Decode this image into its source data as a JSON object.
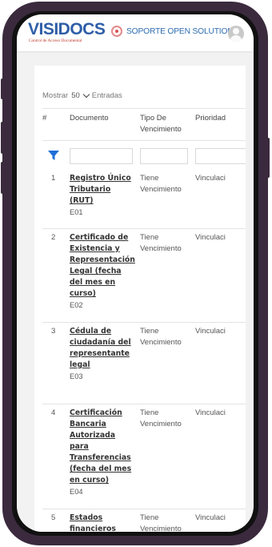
{
  "header": {
    "logo_text": "VISIDOCS",
    "logo_subtitle": "Control de Acceso Documental",
    "support_label": "SOPORTE OPEN SOLUTIONS"
  },
  "table": {
    "show_prefix": "Mostrar",
    "page_size": "50",
    "show_suffix": "Entradas",
    "columns": {
      "num": "#",
      "documento": "Documento",
      "tipo_line1": "Tipo De",
      "tipo_line2": "Vencimiento",
      "prioridad": "Prioridad"
    },
    "rows": [
      {
        "num": "1",
        "name": "Registro Único Tributario (RUT)",
        "code": "E01",
        "tipo1": "Tiene",
        "tipo2": "Vencimiento",
        "prioridad": "Vinculaci"
      },
      {
        "num": "2",
        "name": "Certificado de Existencia y Representación Legal (fecha del mes en curso)",
        "code": "E02",
        "tipo1": "Tiene",
        "tipo2": "Vencimiento",
        "prioridad": "Vinculaci"
      },
      {
        "num": "3",
        "name": "Cédula de ciudadanía del representante legal",
        "code": "E03",
        "tipo1": "Tiene",
        "tipo2": "Vencimiento",
        "prioridad": "Vinculaci"
      },
      {
        "num": "4",
        "name": "Certificación Bancaria Autorizada para Transferencias (fecha del mes en curso)",
        "code": "E04",
        "tipo1": "Tiene",
        "tipo2": "Vencimiento",
        "prioridad": "Vinculaci"
      },
      {
        "num": "5",
        "name": "Estados financieros año actual o fecha",
        "code": "",
        "tipo1": "Tiene",
        "tipo2": "Vencimiento",
        "prioridad": "Vinculaci"
      }
    ]
  },
  "colors": {
    "accent": "#2f5ea8",
    "filter": "#1e6fd9",
    "frame": "#3b2a3e"
  },
  "icons": {
    "filter": "filter-icon",
    "bell": "bell-icon",
    "avatar": "user-avatar-icon",
    "dropdown": "chevron-down-icon"
  }
}
